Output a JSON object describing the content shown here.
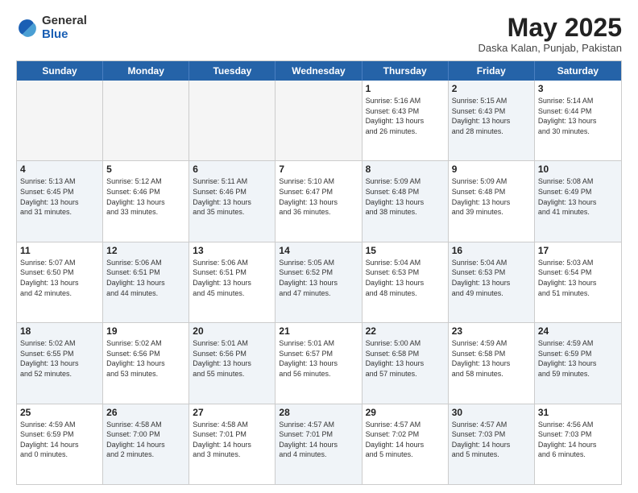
{
  "logo": {
    "general": "General",
    "blue": "Blue"
  },
  "title": "May 2025",
  "location": "Daska Kalan, Punjab, Pakistan",
  "days": [
    "Sunday",
    "Monday",
    "Tuesday",
    "Wednesday",
    "Thursday",
    "Friday",
    "Saturday"
  ],
  "weeks": [
    [
      {
        "day": "",
        "detail": "",
        "empty": true
      },
      {
        "day": "",
        "detail": "",
        "empty": true
      },
      {
        "day": "",
        "detail": "",
        "empty": true
      },
      {
        "day": "",
        "detail": "",
        "empty": true
      },
      {
        "day": "1",
        "detail": "Sunrise: 5:16 AM\nSunset: 6:43 PM\nDaylight: 13 hours\nand 26 minutes."
      },
      {
        "day": "2",
        "detail": "Sunrise: 5:15 AM\nSunset: 6:43 PM\nDaylight: 13 hours\nand 28 minutes.",
        "shaded": true
      },
      {
        "day": "3",
        "detail": "Sunrise: 5:14 AM\nSunset: 6:44 PM\nDaylight: 13 hours\nand 30 minutes."
      }
    ],
    [
      {
        "day": "4",
        "detail": "Sunrise: 5:13 AM\nSunset: 6:45 PM\nDaylight: 13 hours\nand 31 minutes.",
        "shaded": true
      },
      {
        "day": "5",
        "detail": "Sunrise: 5:12 AM\nSunset: 6:46 PM\nDaylight: 13 hours\nand 33 minutes."
      },
      {
        "day": "6",
        "detail": "Sunrise: 5:11 AM\nSunset: 6:46 PM\nDaylight: 13 hours\nand 35 minutes.",
        "shaded": true
      },
      {
        "day": "7",
        "detail": "Sunrise: 5:10 AM\nSunset: 6:47 PM\nDaylight: 13 hours\nand 36 minutes."
      },
      {
        "day": "8",
        "detail": "Sunrise: 5:09 AM\nSunset: 6:48 PM\nDaylight: 13 hours\nand 38 minutes.",
        "shaded": true
      },
      {
        "day": "9",
        "detail": "Sunrise: 5:09 AM\nSunset: 6:48 PM\nDaylight: 13 hours\nand 39 minutes."
      },
      {
        "day": "10",
        "detail": "Sunrise: 5:08 AM\nSunset: 6:49 PM\nDaylight: 13 hours\nand 41 minutes.",
        "shaded": true
      }
    ],
    [
      {
        "day": "11",
        "detail": "Sunrise: 5:07 AM\nSunset: 6:50 PM\nDaylight: 13 hours\nand 42 minutes."
      },
      {
        "day": "12",
        "detail": "Sunrise: 5:06 AM\nSunset: 6:51 PM\nDaylight: 13 hours\nand 44 minutes.",
        "shaded": true
      },
      {
        "day": "13",
        "detail": "Sunrise: 5:06 AM\nSunset: 6:51 PM\nDaylight: 13 hours\nand 45 minutes."
      },
      {
        "day": "14",
        "detail": "Sunrise: 5:05 AM\nSunset: 6:52 PM\nDaylight: 13 hours\nand 47 minutes.",
        "shaded": true
      },
      {
        "day": "15",
        "detail": "Sunrise: 5:04 AM\nSunset: 6:53 PM\nDaylight: 13 hours\nand 48 minutes."
      },
      {
        "day": "16",
        "detail": "Sunrise: 5:04 AM\nSunset: 6:53 PM\nDaylight: 13 hours\nand 49 minutes.",
        "shaded": true
      },
      {
        "day": "17",
        "detail": "Sunrise: 5:03 AM\nSunset: 6:54 PM\nDaylight: 13 hours\nand 51 minutes."
      }
    ],
    [
      {
        "day": "18",
        "detail": "Sunrise: 5:02 AM\nSunset: 6:55 PM\nDaylight: 13 hours\nand 52 minutes.",
        "shaded": true
      },
      {
        "day": "19",
        "detail": "Sunrise: 5:02 AM\nSunset: 6:56 PM\nDaylight: 13 hours\nand 53 minutes."
      },
      {
        "day": "20",
        "detail": "Sunrise: 5:01 AM\nSunset: 6:56 PM\nDaylight: 13 hours\nand 55 minutes.",
        "shaded": true
      },
      {
        "day": "21",
        "detail": "Sunrise: 5:01 AM\nSunset: 6:57 PM\nDaylight: 13 hours\nand 56 minutes."
      },
      {
        "day": "22",
        "detail": "Sunrise: 5:00 AM\nSunset: 6:58 PM\nDaylight: 13 hours\nand 57 minutes.",
        "shaded": true
      },
      {
        "day": "23",
        "detail": "Sunrise: 4:59 AM\nSunset: 6:58 PM\nDaylight: 13 hours\nand 58 minutes."
      },
      {
        "day": "24",
        "detail": "Sunrise: 4:59 AM\nSunset: 6:59 PM\nDaylight: 13 hours\nand 59 minutes.",
        "shaded": true
      }
    ],
    [
      {
        "day": "25",
        "detail": "Sunrise: 4:59 AM\nSunset: 6:59 PM\nDaylight: 14 hours\nand 0 minutes."
      },
      {
        "day": "26",
        "detail": "Sunrise: 4:58 AM\nSunset: 7:00 PM\nDaylight: 14 hours\nand 2 minutes.",
        "shaded": true
      },
      {
        "day": "27",
        "detail": "Sunrise: 4:58 AM\nSunset: 7:01 PM\nDaylight: 14 hours\nand 3 minutes."
      },
      {
        "day": "28",
        "detail": "Sunrise: 4:57 AM\nSunset: 7:01 PM\nDaylight: 14 hours\nand 4 minutes.",
        "shaded": true
      },
      {
        "day": "29",
        "detail": "Sunrise: 4:57 AM\nSunset: 7:02 PM\nDaylight: 14 hours\nand 5 minutes."
      },
      {
        "day": "30",
        "detail": "Sunrise: 4:57 AM\nSunset: 7:03 PM\nDaylight: 14 hours\nand 5 minutes.",
        "shaded": true
      },
      {
        "day": "31",
        "detail": "Sunrise: 4:56 AM\nSunset: 7:03 PM\nDaylight: 14 hours\nand 6 minutes."
      }
    ]
  ]
}
